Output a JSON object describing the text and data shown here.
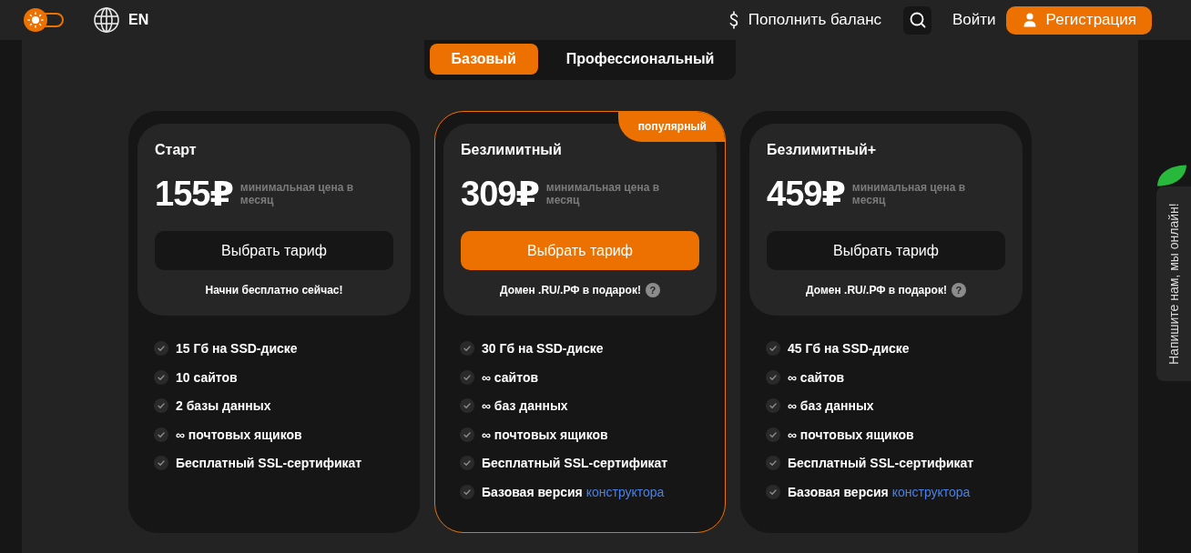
{
  "header": {
    "theme_toggle": {
      "on": false
    },
    "language": "EN",
    "top_up": "Пополнить баланс",
    "login": "Войти",
    "register": "Регистрация"
  },
  "plan_tabs": [
    {
      "label": "Базовый",
      "selected": true
    },
    {
      "label": "Профессиональный",
      "selected": false
    }
  ],
  "plans": [
    {
      "name": "Старт",
      "price": "155₽",
      "price_note": "минимальная цена в месяц",
      "button": "Выбрать тариф",
      "popular": false,
      "note": "Начни бесплатно сейчас!",
      "features": [
        {
          "text": "15 Гб на SSD-диске"
        },
        {
          "text": "10 сайтов"
        },
        {
          "text": "2 базы данных"
        },
        {
          "text": "∞ почтовых ящиков"
        },
        {
          "text": "Бесплатный SSL-сертификат"
        }
      ]
    },
    {
      "name": "Безлимитный",
      "price": "309₽",
      "price_note": "минимальная цена в месяц",
      "button": "Выбрать тариф",
      "popular": true,
      "badge": "популярный",
      "note": "Домен .RU/.РФ в подарок!",
      "note_help": "?",
      "features": [
        {
          "text": "30 Гб на SSD-диске"
        },
        {
          "text": "∞ сайтов"
        },
        {
          "text": "∞ баз данных"
        },
        {
          "text": "∞ почтовых ящиков"
        },
        {
          "text": "Бесплатный SSL-сертификат"
        },
        {
          "text": "Базовая версия",
          "link": "конструктора"
        }
      ]
    },
    {
      "name": "Безлимитный+",
      "price": "459₽",
      "price_note": "минимальная цена в месяц",
      "button": "Выбрать тариф",
      "popular": false,
      "note": "Домен .RU/.РФ в подарок!",
      "note_help": "?",
      "features": [
        {
          "text": "45 Гб на SSD-диске"
        },
        {
          "text": "∞ сайтов"
        },
        {
          "text": "∞ баз данных"
        },
        {
          "text": "∞ почтовых ящиков"
        },
        {
          "text": "Бесплатный SSL-сертификат"
        },
        {
          "text": "Базовая версия",
          "link": "конструктора"
        }
      ]
    }
  ],
  "chat_widget": {
    "label": "Напишите нам, мы онлайн!"
  }
}
